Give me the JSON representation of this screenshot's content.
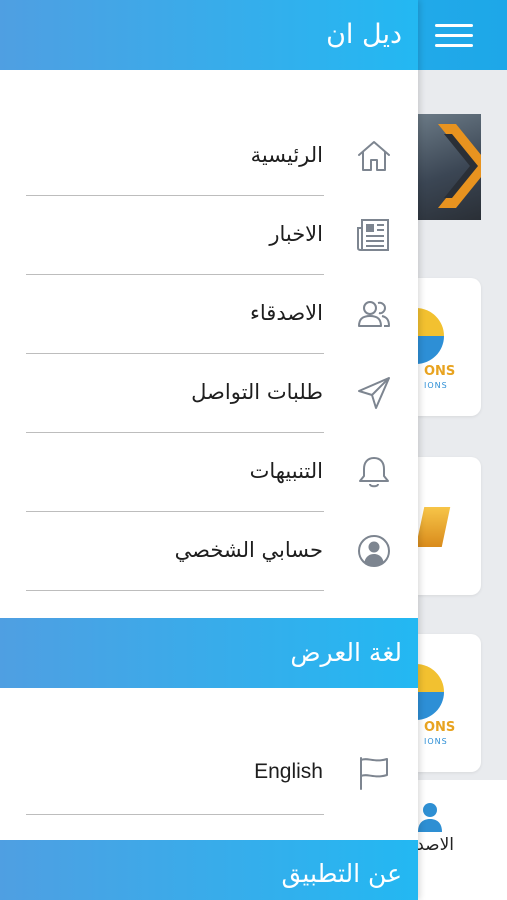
{
  "app": {
    "title": "ديل ان"
  },
  "menu": {
    "items": [
      {
        "label": "الرئيسية",
        "icon": "home-icon"
      },
      {
        "label": "الاخبار",
        "icon": "newspaper-icon"
      },
      {
        "label": "الاصدقاء",
        "icon": "friends-icon"
      },
      {
        "label": "طلبات التواصل",
        "icon": "send-icon"
      },
      {
        "label": "التنبيهات",
        "icon": "bell-icon"
      },
      {
        "label": "حسابي الشخصي",
        "icon": "profile-icon"
      }
    ]
  },
  "language_section": {
    "title": "لغة العرض",
    "option": {
      "label": "English",
      "icon": "flag-icon"
    }
  },
  "about_section": {
    "title": "عن التطبيق"
  },
  "background": {
    "card_brand": "ONS",
    "card_sub": "IONS",
    "bottom_nav_label": "الاصدقاء"
  },
  "colors": {
    "header_gradient_start": "#4f9fe2",
    "header_gradient_end": "#23b8f2",
    "icon_gray": "#7d8590",
    "text": "#1e1e1e"
  }
}
